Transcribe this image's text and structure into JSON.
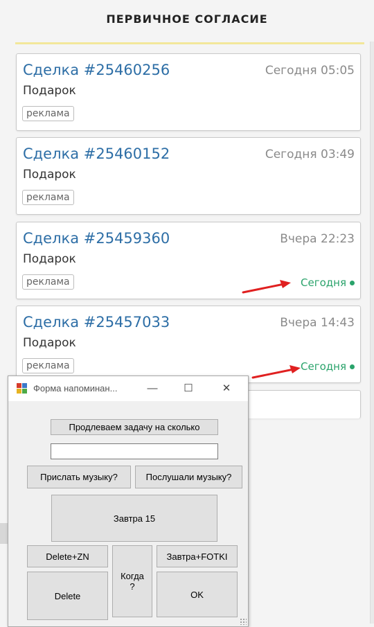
{
  "page": {
    "title": "ПЕРВИЧНОЕ СОГЛАСИЕ",
    "accent_color": "#f2e79a"
  },
  "deals": [
    {
      "title": "Сделка #25460256",
      "time": "Сегодня 05:05",
      "subtitle": "Подарок",
      "tag": "реклама",
      "status": ""
    },
    {
      "title": "Сделка #25460152",
      "time": "Сегодня 03:49",
      "subtitle": "Подарок",
      "tag": "реклама",
      "status": ""
    },
    {
      "title": "Сделка #25459360",
      "time": "Вчера 22:23",
      "subtitle": "Подарок",
      "tag": "реклама",
      "status": "Сегодня"
    },
    {
      "title": "Сделка #25457033",
      "time": "Вчера 14:43",
      "subtitle": "Подарок",
      "tag": "реклама",
      "status": "Сегодня"
    }
  ],
  "colors": {
    "link": "#2d6ea6",
    "status_green": "#2aa36b",
    "arrow_red": "#e02020"
  },
  "form": {
    "title": "Форма напоминан...",
    "minimize": "—",
    "maximize": "☐",
    "close": "✕",
    "extend_label": "Продлеваем задачу на сколько",
    "input_value": "",
    "send_music": "Прислать музыку?",
    "listened_music": "Послушали музыку?",
    "tomorrow15": "Завтра 15",
    "delete_zn": "Delete+ZN",
    "when": "Когда ?",
    "tomorrow_fotki": "Завтра+FOTKI",
    "delete": "Delete",
    "ok": "OK"
  }
}
